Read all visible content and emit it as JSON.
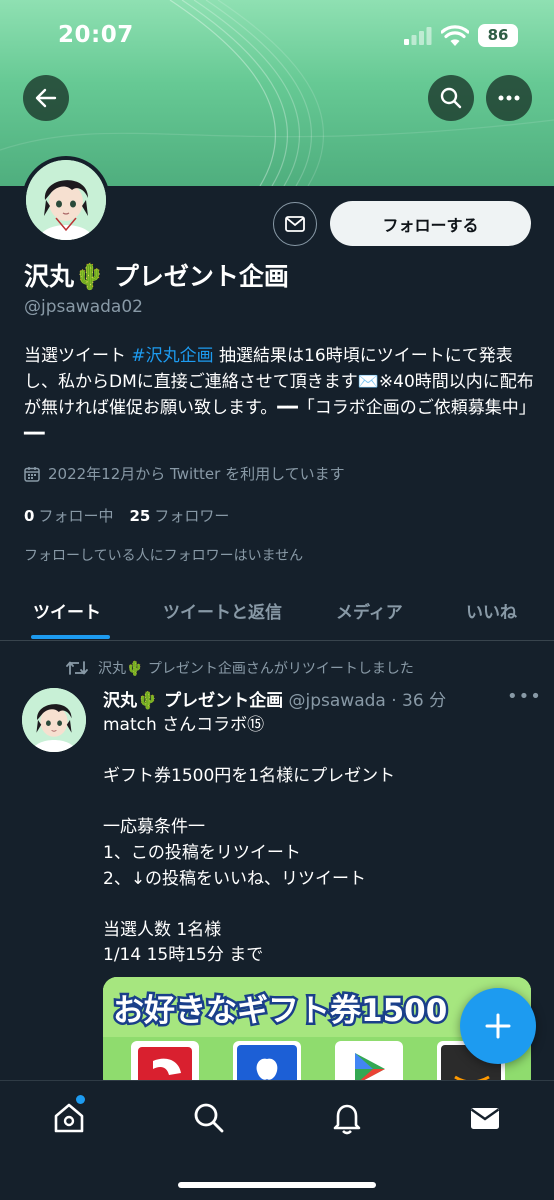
{
  "status_bar": {
    "time": "20:07",
    "battery": "86"
  },
  "profile": {
    "display_name": "沢丸🌵 プレゼント企画",
    "handle": "@jpsawada02",
    "follow_button": "フォローする",
    "bio_prefix": "当選ツイート ",
    "bio_hashtag": "#沢丸企画",
    "bio_rest": " 抽選結果は16時頃にツイートにて発表し、私からDMに直接ご連絡させて頂きます✉️※40時間以内に配布が無ければ催促お願い致します。━━「コラボ企画のご依頼募集中」━━",
    "joined": "2022年12月から Twitter を利用しています",
    "following_count": "0",
    "following_label": "フォロー中",
    "followers_count": "25",
    "followers_label": "フォロワー",
    "no_mutuals": "フォローしている人にフォロワーはいません"
  },
  "tabs": [
    "ツイート",
    "ツイートと返信",
    "メディア",
    "いいね"
  ],
  "tweet": {
    "retweet_note": "沢丸🌵 プレゼント企画さんがリツイートしました",
    "name": "沢丸🌵 プレゼント企画",
    "handle_time": " @jpsawada · 36 分",
    "text": "match さんコラボ⑮\n\nギフト券1500円を1名様にプレゼント\n\n一応募条件一\n1、この投稿をリツイート\n2、↓の投稿をいいね、リツイート\n\n当選人数 1名様\n1/14 15時15分 まで",
    "media_caption": "お好きなギフト券1500"
  },
  "icons": {
    "back": "back-arrow-icon",
    "search": "search-icon",
    "more": "more-icon",
    "message": "envelope-icon",
    "calendar": "calendar-icon",
    "retweet": "retweet-icon",
    "compose": "plus-icon",
    "nav": [
      "home-icon",
      "search-icon",
      "bell-icon",
      "mail-icon"
    ]
  },
  "colors": {
    "accent": "#1d9bf0",
    "background": "#15202b",
    "banner": "#66c994",
    "muted": "#8899a6"
  }
}
